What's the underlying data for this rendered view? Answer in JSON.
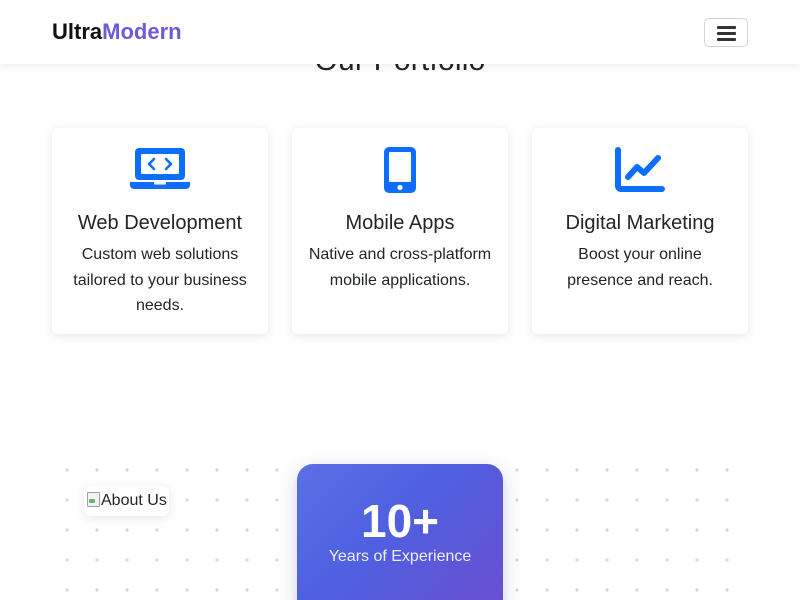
{
  "navbar": {
    "brand_part1": "Ultra",
    "brand_part2": "Modern",
    "toggle_icon": "hamburger-menu-icon"
  },
  "portfolio": {
    "title": "Our Portfolio",
    "accent_color": "#0d6efd",
    "cards": [
      {
        "icon": "laptop-code-icon",
        "title": "Web Development",
        "description": "Custom web solutions tailored to your business needs."
      },
      {
        "icon": "mobile-phone-icon",
        "title": "Mobile Apps",
        "description": "Native and cross-platform mobile applications."
      },
      {
        "icon": "chart-line-icon",
        "title": "Digital Marketing",
        "description": "Boost your online presence and reach."
      }
    ]
  },
  "about": {
    "image_alt": "About Us",
    "experience_number": "10+",
    "experience_label": "Years of Experience",
    "gradient_colors": [
      "#5b6fe6",
      "#6a4fd0"
    ]
  }
}
